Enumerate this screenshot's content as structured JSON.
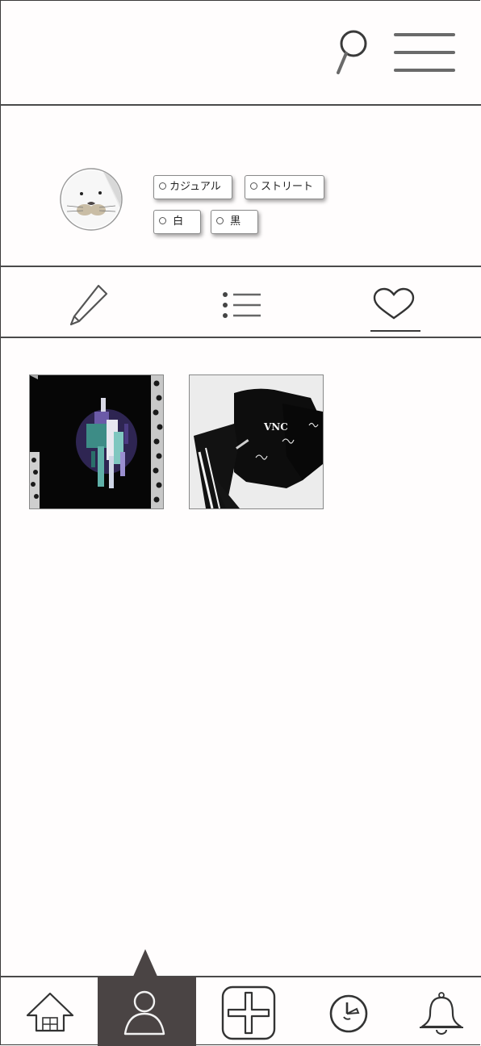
{
  "header": {
    "search_icon": "search-icon",
    "menu_icon": "hamburger-menu-icon"
  },
  "profile": {
    "avatar": "seal-avatar",
    "tags": [
      {
        "label": "カジュアル"
      },
      {
        "label": "ストリート"
      },
      {
        "label": " 白"
      },
      {
        "label": "黒"
      }
    ]
  },
  "tabs": [
    {
      "icon": "pencil-icon",
      "active": false
    },
    {
      "icon": "list-icon",
      "active": false
    },
    {
      "icon": "heart-icon",
      "active": true
    }
  ],
  "grid": {
    "items": [
      {
        "image": "black-graphic-tshirt"
      },
      {
        "image": "black-sweatshirt-set",
        "print_text": "VNC"
      }
    ]
  },
  "bottom_nav": [
    {
      "icon": "home-icon",
      "active": false
    },
    {
      "icon": "profile-icon",
      "active": true
    },
    {
      "icon": "plus-icon",
      "active": false
    },
    {
      "icon": "clock-icon",
      "active": false
    },
    {
      "icon": "bell-icon",
      "active": false
    }
  ],
  "colors": {
    "background": "#fffdfd",
    "line": "#4a4a4a",
    "active_nav": "#4a4444"
  }
}
